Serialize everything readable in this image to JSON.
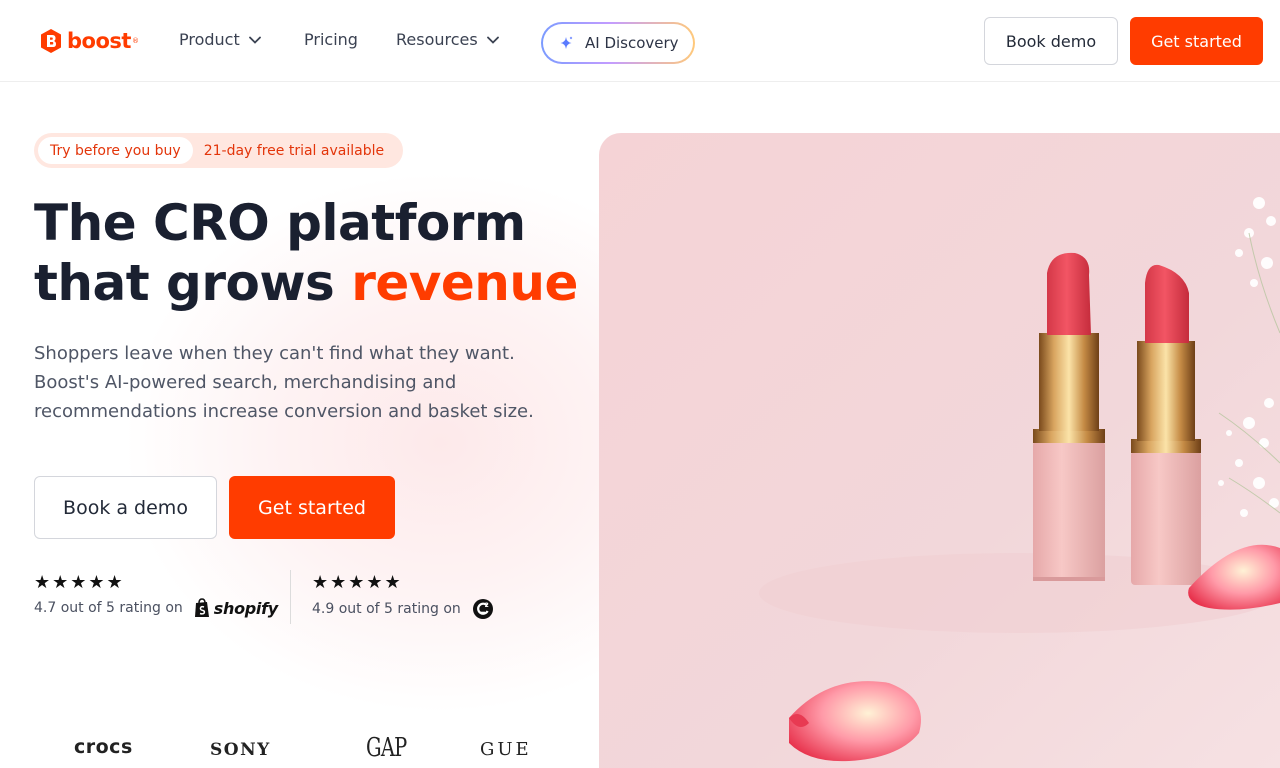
{
  "header": {
    "logo_text": "boost",
    "nav": [
      {
        "label": "Product",
        "has_dropdown": true
      },
      {
        "label": "Pricing",
        "has_dropdown": false
      },
      {
        "label": "Resources",
        "has_dropdown": true
      }
    ],
    "ai_discovery_label": "AI Discovery",
    "book_demo_label": "Book demo",
    "get_started_label": "Get started"
  },
  "hero": {
    "badge_label": "Try before you buy",
    "badge_text": "21-day free trial available",
    "title_line1": "The CRO platform",
    "title_line2_prefix": "that grows ",
    "title_accent": "revenue",
    "description": "Shoppers leave when they can't find what they want. Boost's AI-powered search, merchandising and recommendations increase conversion and basket size.",
    "book_demo_label": "Book a demo",
    "get_started_label": "Get started"
  },
  "ratings": [
    {
      "stars": "★★★★★",
      "text": "4.7 out of 5 rating on",
      "platform": "shopify",
      "rating": 4.7,
      "max": 5
    },
    {
      "stars": "★★★★★",
      "text": "4.9 out of 5 rating on",
      "platform": "G2",
      "rating": 4.9,
      "max": 5
    }
  ],
  "brands": [
    "crocs",
    "SONY",
    "GAP",
    "GUE"
  ],
  "image": {
    "subject": "two pink lipsticks with rose petals and white flowers"
  },
  "colors": {
    "brand": "#ff3c00",
    "text_dark": "#1a2030",
    "text_muted": "#4f5666",
    "badge_bg": "#ffe7e0",
    "hero_bg": "#f5d6d8"
  }
}
